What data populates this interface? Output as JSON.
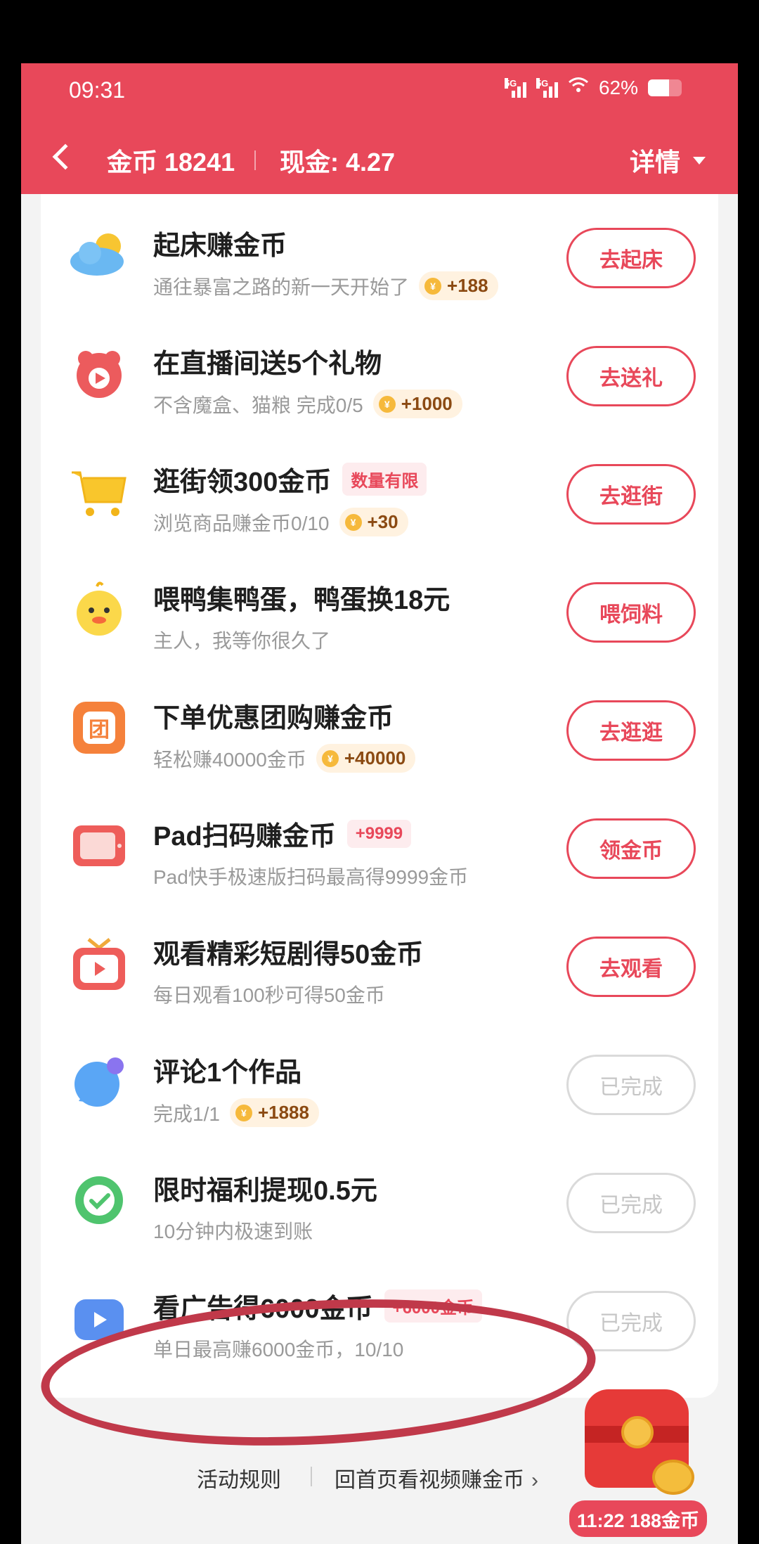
{
  "status_bar": {
    "time": "09:31",
    "battery": "62%",
    "battery_level": 0.62,
    "network": "5G"
  },
  "nav": {
    "coins_label": "金币 18241",
    "cash_label": "现金: 4.27",
    "detail_label": "详情"
  },
  "tasks": [
    {
      "title": "起床赚金币",
      "tag": "",
      "sub": "通往暴富之路的新一天开始了",
      "reward": "+188",
      "button": "去起床",
      "done": false,
      "icon": "cloud-sun-icon"
    },
    {
      "title": "在直播间送5个礼物",
      "tag": "",
      "sub": "不含魔盒、猫粮 完成0/5",
      "reward": "+1000",
      "button": "去送礼",
      "done": false,
      "icon": "gift-live-icon"
    },
    {
      "title": "逛街领300金币",
      "tag": "数量有限",
      "sub": "浏览商品赚金币0/10",
      "reward": "+30",
      "button": "去逛街",
      "done": false,
      "icon": "shopping-cart-icon"
    },
    {
      "title": "喂鸭集鸭蛋，鸭蛋换18元",
      "tag": "",
      "sub": "主人，我等你很久了",
      "reward": "",
      "button": "喂饲料",
      "done": false,
      "icon": "duck-icon"
    },
    {
      "title": "下单优惠团购赚金币",
      "tag": "",
      "sub": "轻松赚40000金币",
      "reward": "+40000",
      "button": "去逛逛",
      "done": false,
      "icon": "group-buy-icon"
    },
    {
      "title": "Pad扫码赚金币",
      "tag": "+9999",
      "sub": "Pad快手极速版扫码最高得9999金币",
      "reward": "",
      "button": "领金币",
      "done": false,
      "icon": "tablet-icon"
    },
    {
      "title": "观看精彩短剧得50金币",
      "tag": "",
      "sub": "每日观看100秒可得50金币",
      "reward": "",
      "button": "去观看",
      "done": false,
      "icon": "tv-play-icon"
    },
    {
      "title": "评论1个作品",
      "tag": "",
      "sub": "完成1/1",
      "reward": "+1888",
      "button": "已完成",
      "done": true,
      "icon": "comment-bubble-icon"
    },
    {
      "title": "限时福利提现0.5元",
      "tag": "",
      "sub": "10分钟内极速到账",
      "reward": "",
      "button": "已完成",
      "done": true,
      "icon": "withdraw-check-icon"
    },
    {
      "title": "看广告得6000金币",
      "tag": "+6000金币",
      "sub": "单日最高赚6000金币，10/10",
      "reward": "",
      "button": "已完成",
      "done": true,
      "icon": "video-ad-icon"
    }
  ],
  "coin_glyph": "¥",
  "footer": {
    "rules": "活动规则",
    "home": "回首页看视频赚金币",
    "chevron": "›"
  },
  "float_widget": {
    "label": "11:22 188金币"
  },
  "colors": {
    "primary": "#e8485a",
    "done_border": "#dadada",
    "annotation": "#c0394a"
  }
}
